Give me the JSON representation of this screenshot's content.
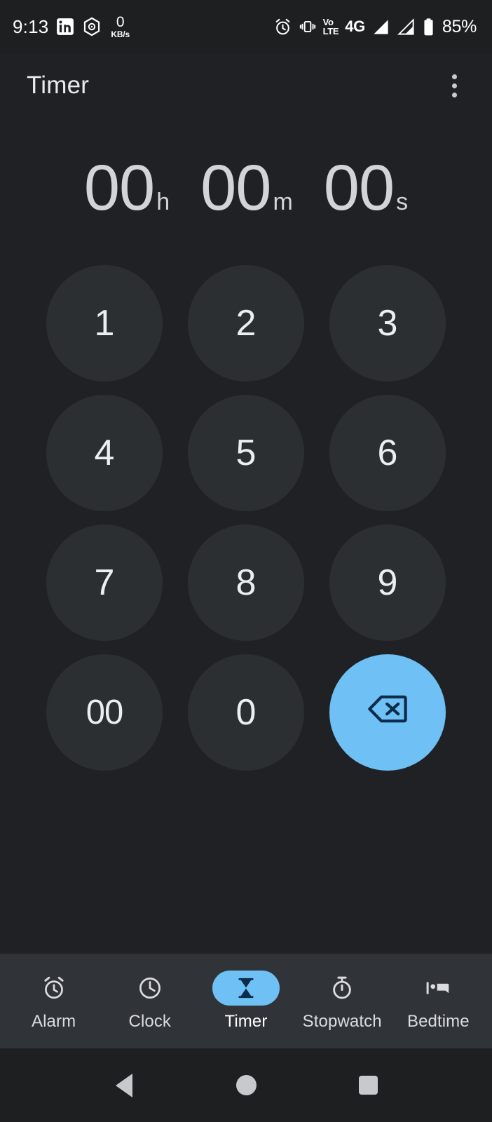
{
  "status_bar": {
    "time": "9:13",
    "icons_left": [
      "linkedin-icon",
      "hexagon-app-icon"
    ],
    "network_speed": {
      "value": "0",
      "unit": "KB/s"
    },
    "alarm_icon": "alarm-icon",
    "vibrate_icon": "vibrate-icon",
    "volte": {
      "line1": "Vo",
      "line2": "LTE"
    },
    "network_type": "4G",
    "signal_icons": [
      "signal-full-icon",
      "signal-partial-icon"
    ],
    "battery": "85%"
  },
  "app_bar": {
    "title": "Timer",
    "overflow_label": "More options"
  },
  "time_display": {
    "hours": {
      "digits": "00",
      "unit": "h"
    },
    "minutes": {
      "digits": "00",
      "unit": "m"
    },
    "seconds": {
      "digits": "00",
      "unit": "s"
    }
  },
  "keypad": {
    "keys": [
      {
        "label": "1",
        "name": "key-1"
      },
      {
        "label": "2",
        "name": "key-2"
      },
      {
        "label": "3",
        "name": "key-3"
      },
      {
        "label": "4",
        "name": "key-4"
      },
      {
        "label": "5",
        "name": "key-5"
      },
      {
        "label": "6",
        "name": "key-6"
      },
      {
        "label": "7",
        "name": "key-7"
      },
      {
        "label": "8",
        "name": "key-8"
      },
      {
        "label": "9",
        "name": "key-9"
      },
      {
        "label": "00",
        "name": "key-00"
      },
      {
        "label": "0",
        "name": "key-0"
      },
      {
        "label": "",
        "name": "key-backspace"
      }
    ]
  },
  "bottom_nav": {
    "items": [
      {
        "label": "Alarm",
        "icon": "alarm-clock-icon",
        "active": false
      },
      {
        "label": "Clock",
        "icon": "clock-icon",
        "active": false
      },
      {
        "label": "Timer",
        "icon": "hourglass-icon",
        "active": true
      },
      {
        "label": "Stopwatch",
        "icon": "stopwatch-icon",
        "active": false
      },
      {
        "label": "Bedtime",
        "icon": "bed-icon",
        "active": false
      }
    ]
  },
  "android_nav": {
    "back": "back-button",
    "home": "home-button",
    "recents": "recents-button"
  },
  "colors": {
    "background": "#202124",
    "key_fill": "#2c2f32",
    "accent": "#6ec0f5",
    "accent_dark": "#0d2b4a",
    "nav_bar": "#303438",
    "text_primary": "#e8eaed",
    "text_display": "#d2d4d6"
  }
}
